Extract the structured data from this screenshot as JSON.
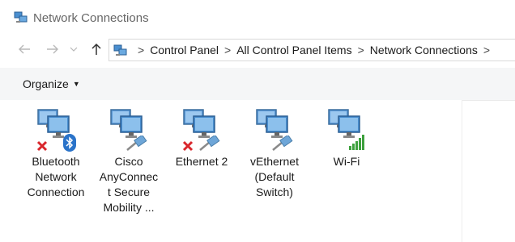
{
  "window": {
    "title": "Network Connections"
  },
  "breadcrumb": [
    "Control Panel",
    "All Control Panel Items",
    "Network Connections"
  ],
  "toolbar": {
    "organize_label": "Organize"
  },
  "connections": [
    {
      "label_lines": [
        "Bluetooth",
        "Network",
        "Connection"
      ],
      "status": "disconnected",
      "adapter": "bluetooth"
    },
    {
      "label_lines": [
        "Cisco",
        "AnyConnec",
        "t Secure",
        "Mobility ..."
      ],
      "status": "ok",
      "adapter": "cable"
    },
    {
      "label_lines": [
        "Ethernet 2"
      ],
      "status": "disconnected",
      "adapter": "cable"
    },
    {
      "label_lines": [
        "vEthernet",
        "(Default",
        "Switch)"
      ],
      "status": "ok",
      "adapter": "cable"
    },
    {
      "label_lines": [
        "Wi-Fi"
      ],
      "status": "ok",
      "adapter": "wifi-signal"
    }
  ],
  "colors": {
    "error_x": "#d9262c",
    "bluetooth": "#2a73c9",
    "signal": "#3ea13e",
    "monitor": "#4a8fd0"
  }
}
